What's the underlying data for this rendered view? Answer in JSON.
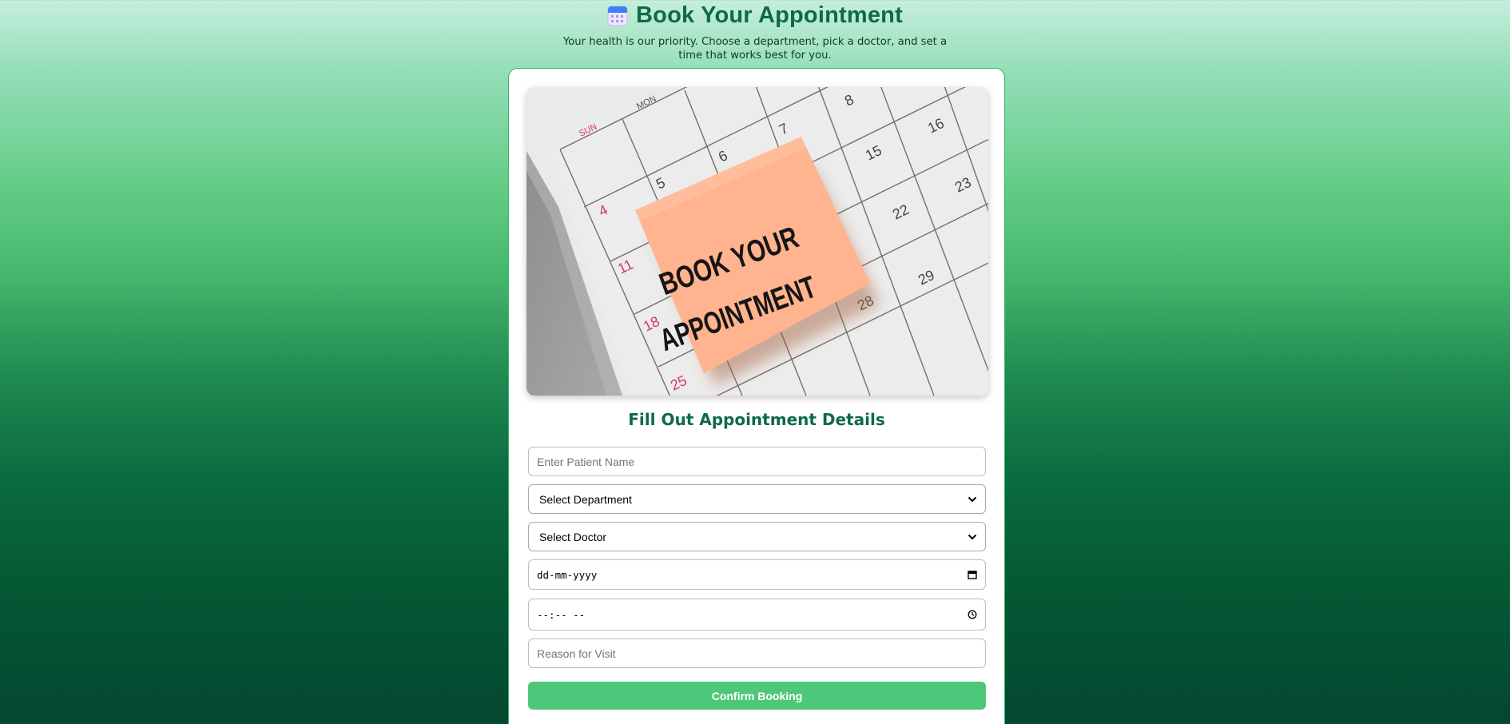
{
  "header": {
    "title": "Book Your Appointment",
    "title_icon": "calendar-icon",
    "subtitle": "Your health is our priority. Choose a department, pick a doctor, and set a time that works best for you."
  },
  "hero": {
    "note_line1": "BOOK YOUR",
    "note_line2": "APPOINTMENT",
    "weekday_sun": "SUN",
    "weekday_mon": "MON",
    "dates": [
      "4",
      "5",
      "6",
      "7",
      "8",
      "11",
      "15",
      "16",
      "18",
      "22",
      "23",
      "25",
      "28",
      "29"
    ]
  },
  "form": {
    "heading": "Fill Out Appointment Details",
    "patient_name_placeholder": "Enter Patient Name",
    "department_selected": "Select Department",
    "doctor_selected": "Select Doctor",
    "date_placeholder": "dd-mm-yyyy",
    "time_placeholder": "--:-- --",
    "reason_placeholder": "Reason for Visit",
    "submit_label": "Confirm Booking"
  },
  "colors": {
    "accent": "#0d6b45",
    "button": "#4fc77a",
    "note": "#ffb48f",
    "sunday_red": "#d6336c"
  }
}
